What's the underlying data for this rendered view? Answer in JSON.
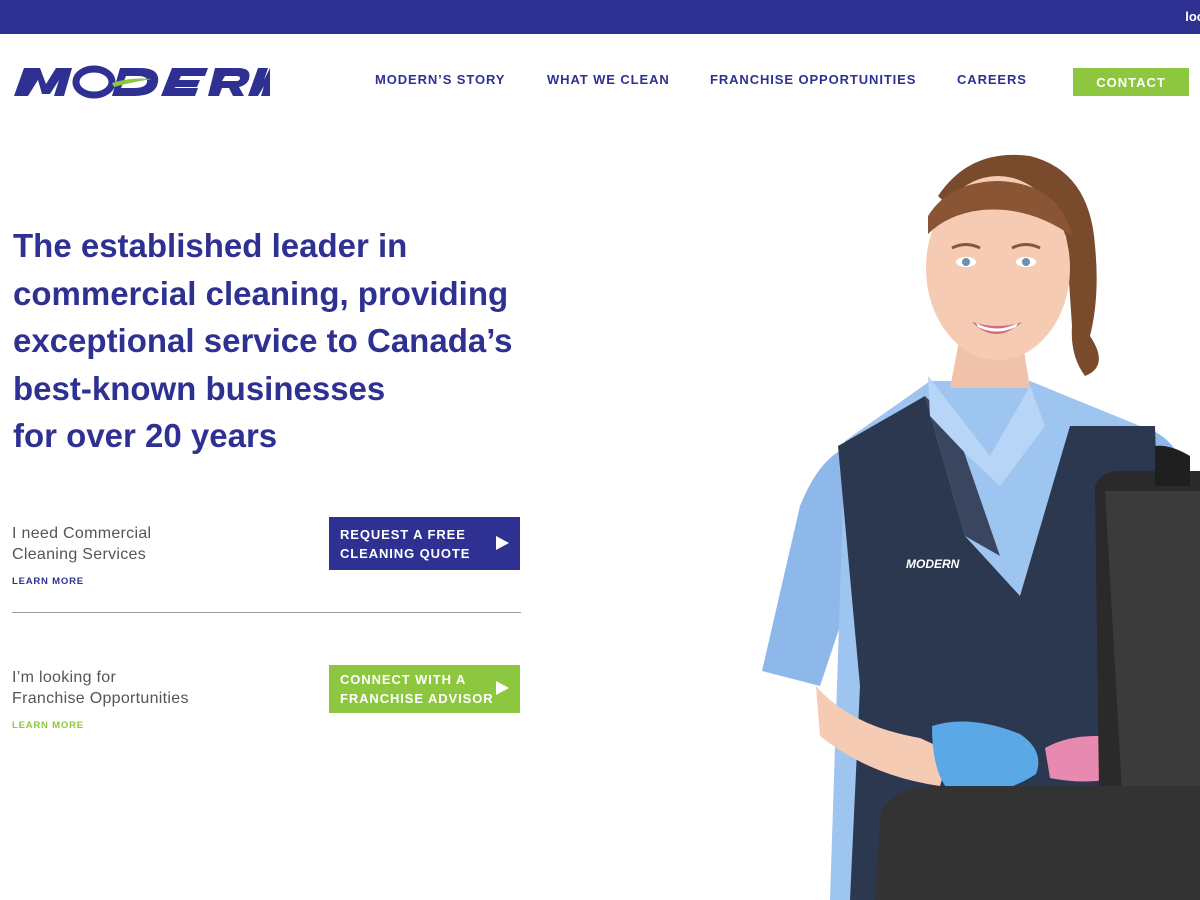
{
  "topbar": {
    "link_label": "loc"
  },
  "logo": {
    "text": "MODERN"
  },
  "nav": {
    "items": [
      {
        "label": "MODERN’S STORY"
      },
      {
        "label": "WHAT WE CLEAN"
      },
      {
        "label": "FRANCHISE OPPORTUNITIES"
      },
      {
        "label": "CAREERS"
      }
    ],
    "contact_label": "CONTACT"
  },
  "hero": {
    "headline_lines": [
      "The established leader in",
      "commercial cleaning, providing",
      "exceptional service to Canada’s",
      "best-known businesses",
      "for over 20 years"
    ],
    "photo_vest_logo": "MODERN"
  },
  "cta": [
    {
      "text_lines": [
        "I need Commercial",
        "Cleaning Services"
      ],
      "learn_more": "LEARN MORE",
      "button_lines": [
        "REQUEST A FREE",
        "CLEANING QUOTE"
      ]
    },
    {
      "text_lines": [
        "I’m looking for",
        "Franchise Opportunities"
      ],
      "learn_more": "LEARN MORE",
      "button_lines": [
        "CONNECT WITH A",
        "FRANCHISE ADVISOR"
      ]
    }
  ],
  "colors": {
    "brand_navy": "#2e3192",
    "brand_green": "#8dc63f",
    "body_text": "#555555"
  },
  "icons": [
    "play-arrow-icon"
  ]
}
